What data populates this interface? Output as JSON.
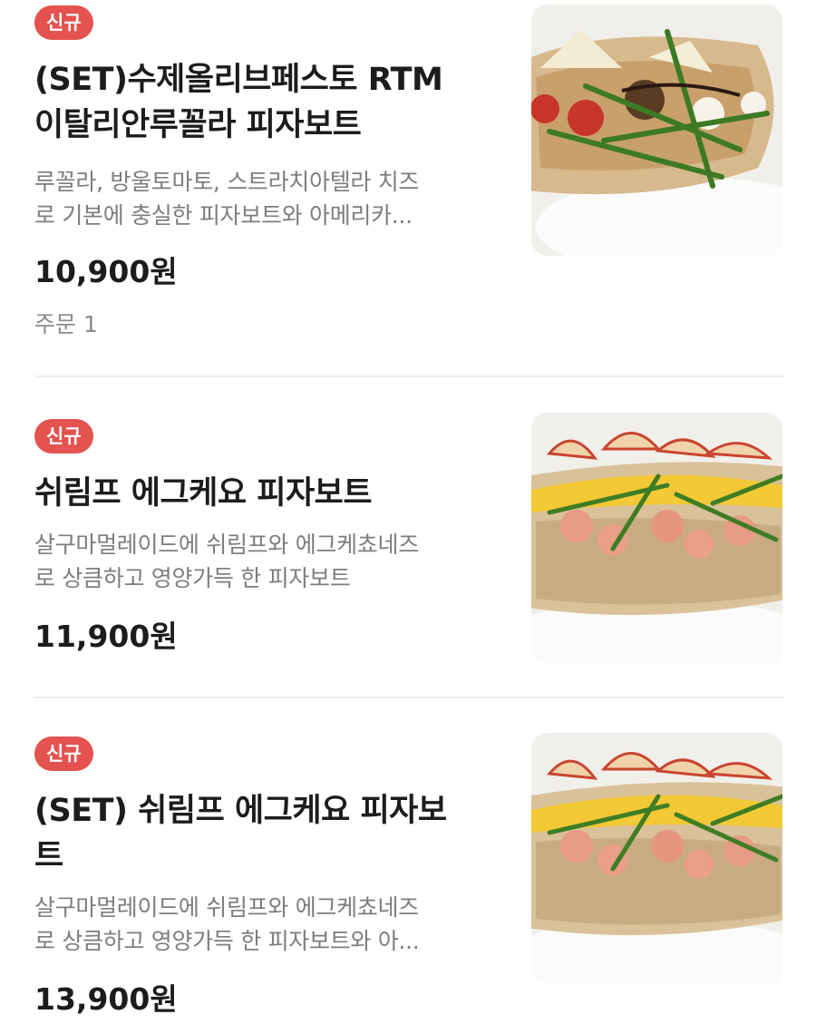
{
  "menu_items": [
    {
      "badge": "신규",
      "title": "(SET)수제올리브페스토 RTM\n이탈리안루꼴라 피자보트",
      "desc_line1": "루꼴라, 방울토마토, 스트라치아텔라 치즈",
      "desc_line2": "로 기본에 충실한 피자보트와 아메리카...",
      "price": "10,900원",
      "orders": "주문 1"
    },
    {
      "badge": "신규",
      "title": "쉬림프 에그케요 피자보트",
      "desc_line1": "살구마멀레이드에 쉬림프와 에그케쵸네즈",
      "desc_line2": "로 상큼하고 영양가득 한 피자보트",
      "price": "11,900원"
    },
    {
      "badge": "신규",
      "title": "(SET) 쉬림프 에그케요 피자보\n트",
      "desc_line1": "살구마멀레이드에 쉬림프와 에그케쵸네즈",
      "desc_line2": "로 상큼하고 영양가득 한 피자보트와 아...",
      "price": "13,900원"
    }
  ],
  "colors": {
    "badge": "#e4534f",
    "price": "#1c1c1c",
    "description": "#7d7d7d",
    "divider": "#ececec"
  },
  "icons": [
    "rucola-pizza-boat-photo",
    "shrimp-pizza-boat-photo",
    "shrimp-pizza-boat-photo"
  ]
}
